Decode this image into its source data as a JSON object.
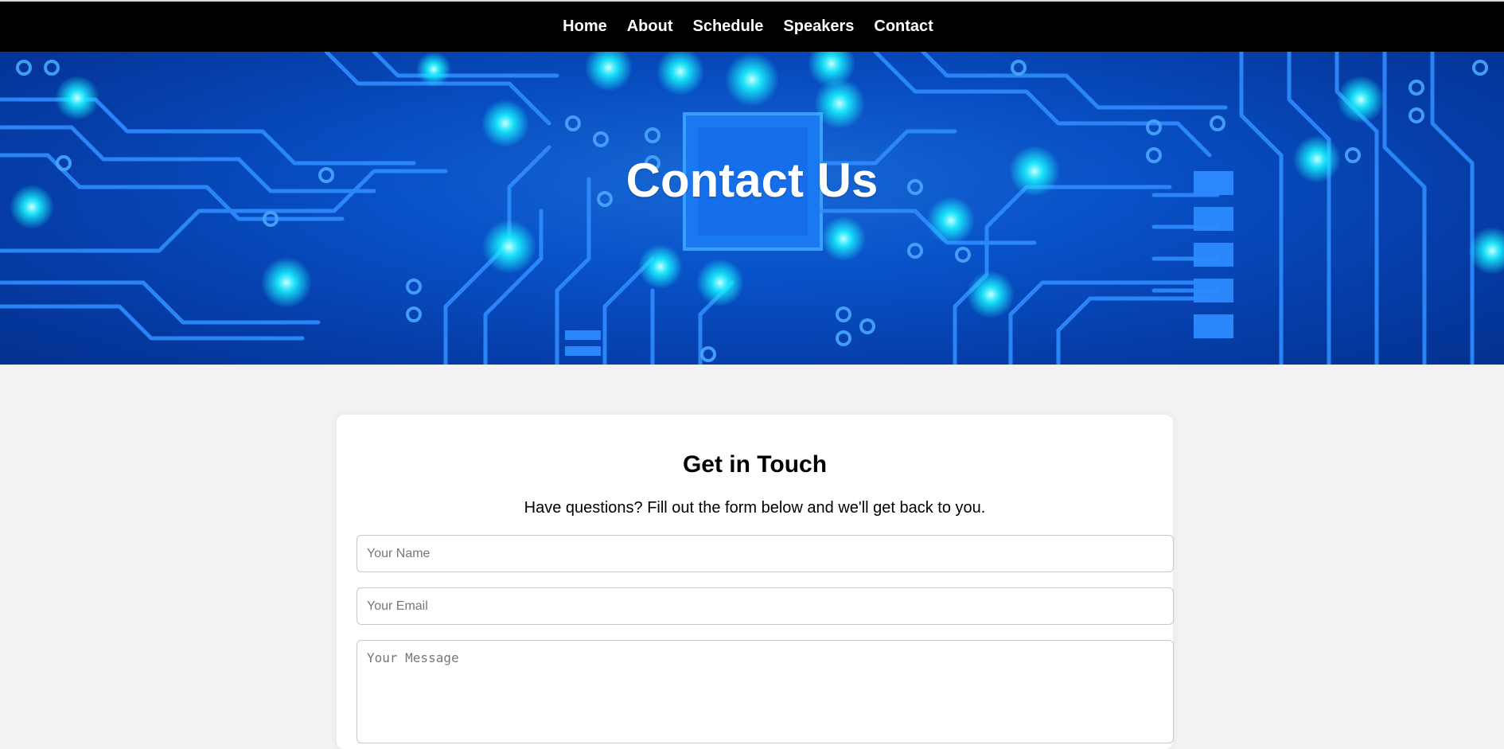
{
  "nav": {
    "items": [
      {
        "label": "Home"
      },
      {
        "label": "About"
      },
      {
        "label": "Schedule"
      },
      {
        "label": "Speakers"
      },
      {
        "label": "Contact"
      }
    ]
  },
  "hero": {
    "title": "Contact Us"
  },
  "contact": {
    "heading": "Get in Touch",
    "intro": "Have questions? Fill out the form below and we'll get back to you.",
    "name_placeholder": "Your Name",
    "email_placeholder": "Your Email",
    "message_placeholder": "Your Message",
    "name_value": "",
    "email_value": "",
    "message_value": ""
  },
  "colors": {
    "nav_bg": "#000000",
    "hero_blue": "#0a5fe0",
    "circuit_glow": "#19f0ff",
    "page_bg": "#f2f2f2",
    "card_bg": "#ffffff"
  }
}
